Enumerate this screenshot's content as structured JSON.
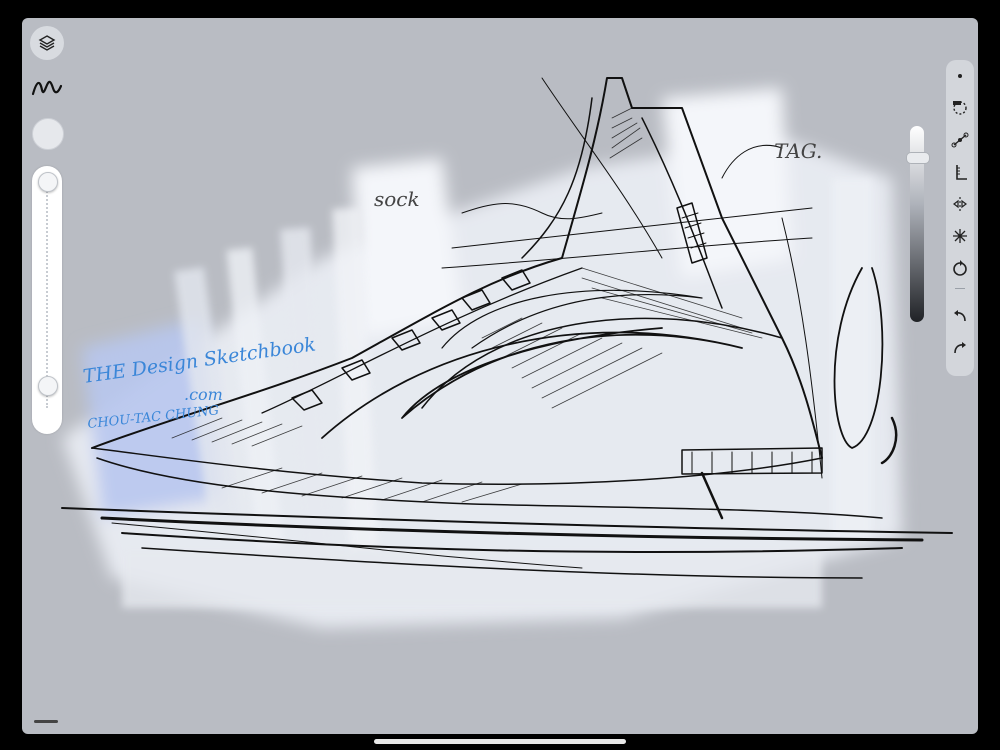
{
  "canvas": {
    "annotations": {
      "sock": "sock",
      "tag": "TAG.",
      "watermark_line1": "THE Design Sketchbook",
      "watermark_line2": ".com",
      "author": "CHOU-TAC CHUNG"
    }
  },
  "icons": {
    "layers": "layers-icon",
    "brush": "brush-icon",
    "color": "color-swatch",
    "dot": "dot-icon",
    "selection": "selection-lasso-icon",
    "curve": "bezier-curve-icon",
    "ruler": "ruler-icon",
    "symmetry": "symmetry-icon",
    "radial": "radial-symmetry-icon",
    "rotate": "rotate-canvas-icon",
    "undo": "undo-icon",
    "redo": "redo-icon"
  },
  "colors": {
    "canvas_bg": "#b9bcc3",
    "sketch_ink": "#111111",
    "watermark_blue": "#3a86d8"
  }
}
